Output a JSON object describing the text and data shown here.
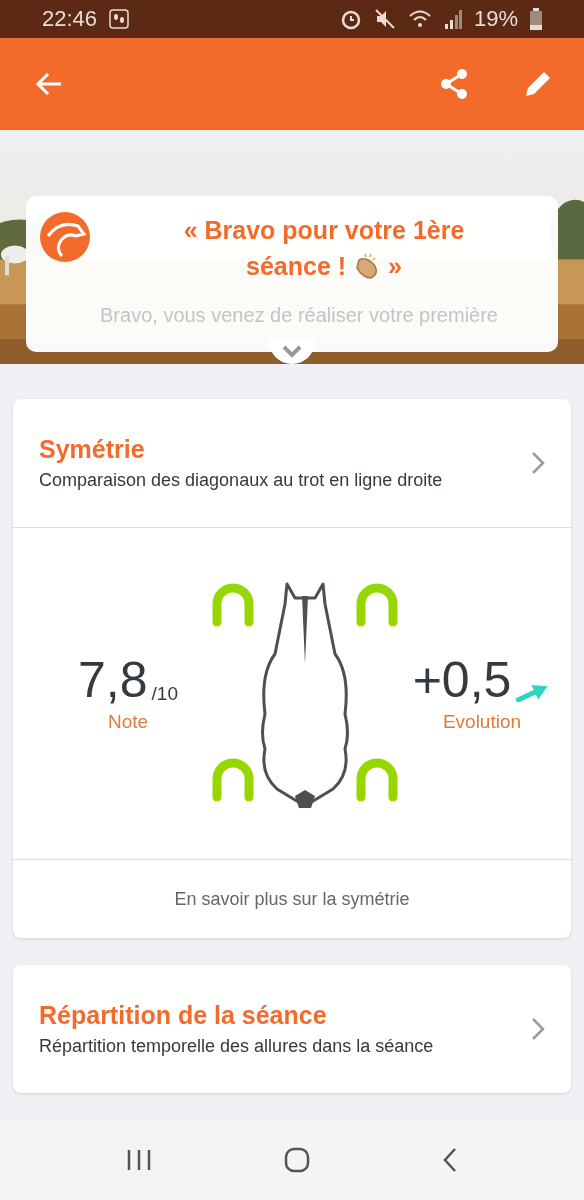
{
  "status_bar": {
    "time": "22:46",
    "battery": "19%"
  },
  "banner": {
    "title": "« Bravo pour votre 1ère séance !",
    "title_end": "»",
    "text": "Bravo, vous venez de réaliser votre première"
  },
  "cards": [
    {
      "kind": "score",
      "title": "Symétrie",
      "subtitle": "Comparaison des diagonaux au trot en ligne droite",
      "score": "7,8",
      "score_max": "/10",
      "score_label": "Note",
      "evolution": "+0,5",
      "evolution_label": "Evolution",
      "rising": true,
      "link": "En savoir plus sur la symétrie"
    },
    {
      "kind": "summary",
      "title": "Répartition de la séance",
      "subtitle": "Répartition temporelle des allures dans la séance"
    }
  ]
}
